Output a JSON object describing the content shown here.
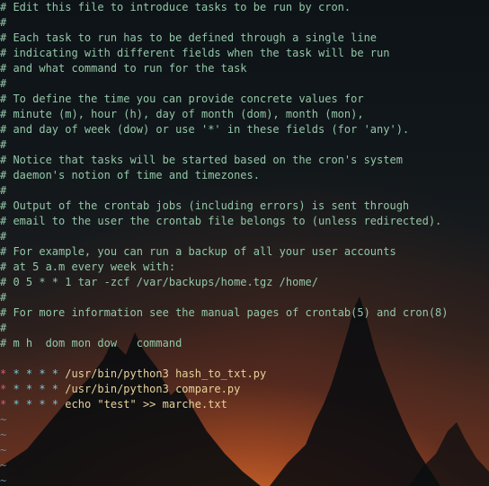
{
  "crontab": {
    "comment_lines": [
      "# Edit this file to introduce tasks to be run by cron.",
      "#",
      "# Each task to run has to be defined through a single line",
      "# indicating with different fields when the task will be run",
      "# and what command to run for the task",
      "#",
      "# To define the time you can provide concrete values for",
      "# minute (m), hour (h), day of month (dom), month (mon),",
      "# and day of week (dow) or use '*' in these fields (for 'any').",
      "#",
      "# Notice that tasks will be started based on the cron's system",
      "# daemon's notion of time and timezones.",
      "#",
      "# Output of the crontab jobs (including errors) is sent through",
      "# email to the user the crontab file belongs to (unless redirected).",
      "#",
      "# For example, you can run a backup of all your user accounts",
      "# at 5 a.m every week with:",
      "# 0 5 * * 1 tar -zcf /var/backups/home.tgz /home/",
      "#",
      "# For more information see the manual pages of crontab(5) and cron(8)",
      "#",
      "# m h  dom mon dow   command"
    ],
    "blank_line": "",
    "jobs": [
      {
        "schedule_first": "*",
        "schedule_rest": " * * * * ",
        "command": "/usr/bin/python3 hash_to_txt.py"
      },
      {
        "schedule_first": "*",
        "schedule_rest": " * * * * ",
        "command": "/usr/bin/python3 compare.py"
      },
      {
        "schedule_first": "*",
        "schedule_rest": " * * * * ",
        "command": "echo \"test\" >> marche.txt"
      }
    ],
    "empty_markers": [
      "~",
      "~",
      "~",
      "~",
      "~"
    ]
  },
  "colors": {
    "comment": "#93c7a8",
    "schedule_first_star": "#e0567a",
    "schedule_stars": "#78c8dc",
    "command": "#e6d29a",
    "tilde": "#6a8aa0"
  }
}
